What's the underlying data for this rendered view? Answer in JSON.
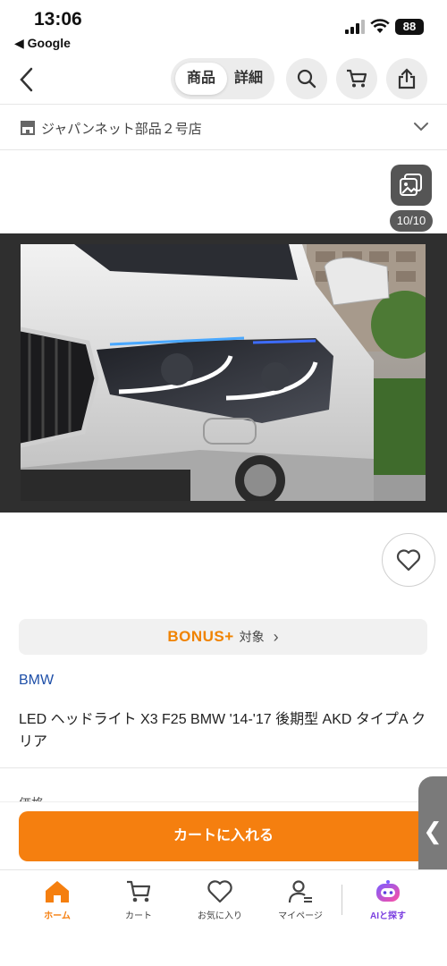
{
  "status_bar": {
    "time": "13:06",
    "back_app": "◀ Google",
    "battery": "88"
  },
  "header": {
    "tabs": [
      {
        "label": "商品"
      },
      {
        "label": "詳細"
      }
    ],
    "icons": [
      "back-chevron-icon",
      "search-icon",
      "cart-icon",
      "share-icon"
    ]
  },
  "shop": {
    "name": "ジャパンネット部品２号店",
    "icon": "store-icon"
  },
  "gallery": {
    "counter": "10/10",
    "icon": "gallery-icon"
  },
  "bonus": {
    "logo": "BONUS+",
    "text": "対象",
    "arrow": "›"
  },
  "product": {
    "brand": "BMW",
    "title": "LED ヘッドライト X3 F25 BMW '14-'17 後期型 AKD タイプA クリア",
    "peek_text": "価格"
  },
  "cart": {
    "button_label": "カートに入れる"
  },
  "side_tab": {
    "glyph": "❮"
  },
  "nav": {
    "items": [
      {
        "label": "ホーム",
        "icon": "home-icon",
        "active": true
      },
      {
        "label": "カート",
        "icon": "cart-icon"
      },
      {
        "label": "お気に入り",
        "icon": "heart-icon"
      },
      {
        "label": "マイページ",
        "icon": "user-icon"
      },
      {
        "label": "AIと探す",
        "icon": "ai-robot-icon"
      }
    ]
  },
  "colors": {
    "accent": "#f57f0f",
    "brand_link": "#1e4fa8",
    "active_nav": "#f57f0f",
    "ai_gradient": [
      "#7b5cff",
      "#ff4fa3"
    ]
  }
}
